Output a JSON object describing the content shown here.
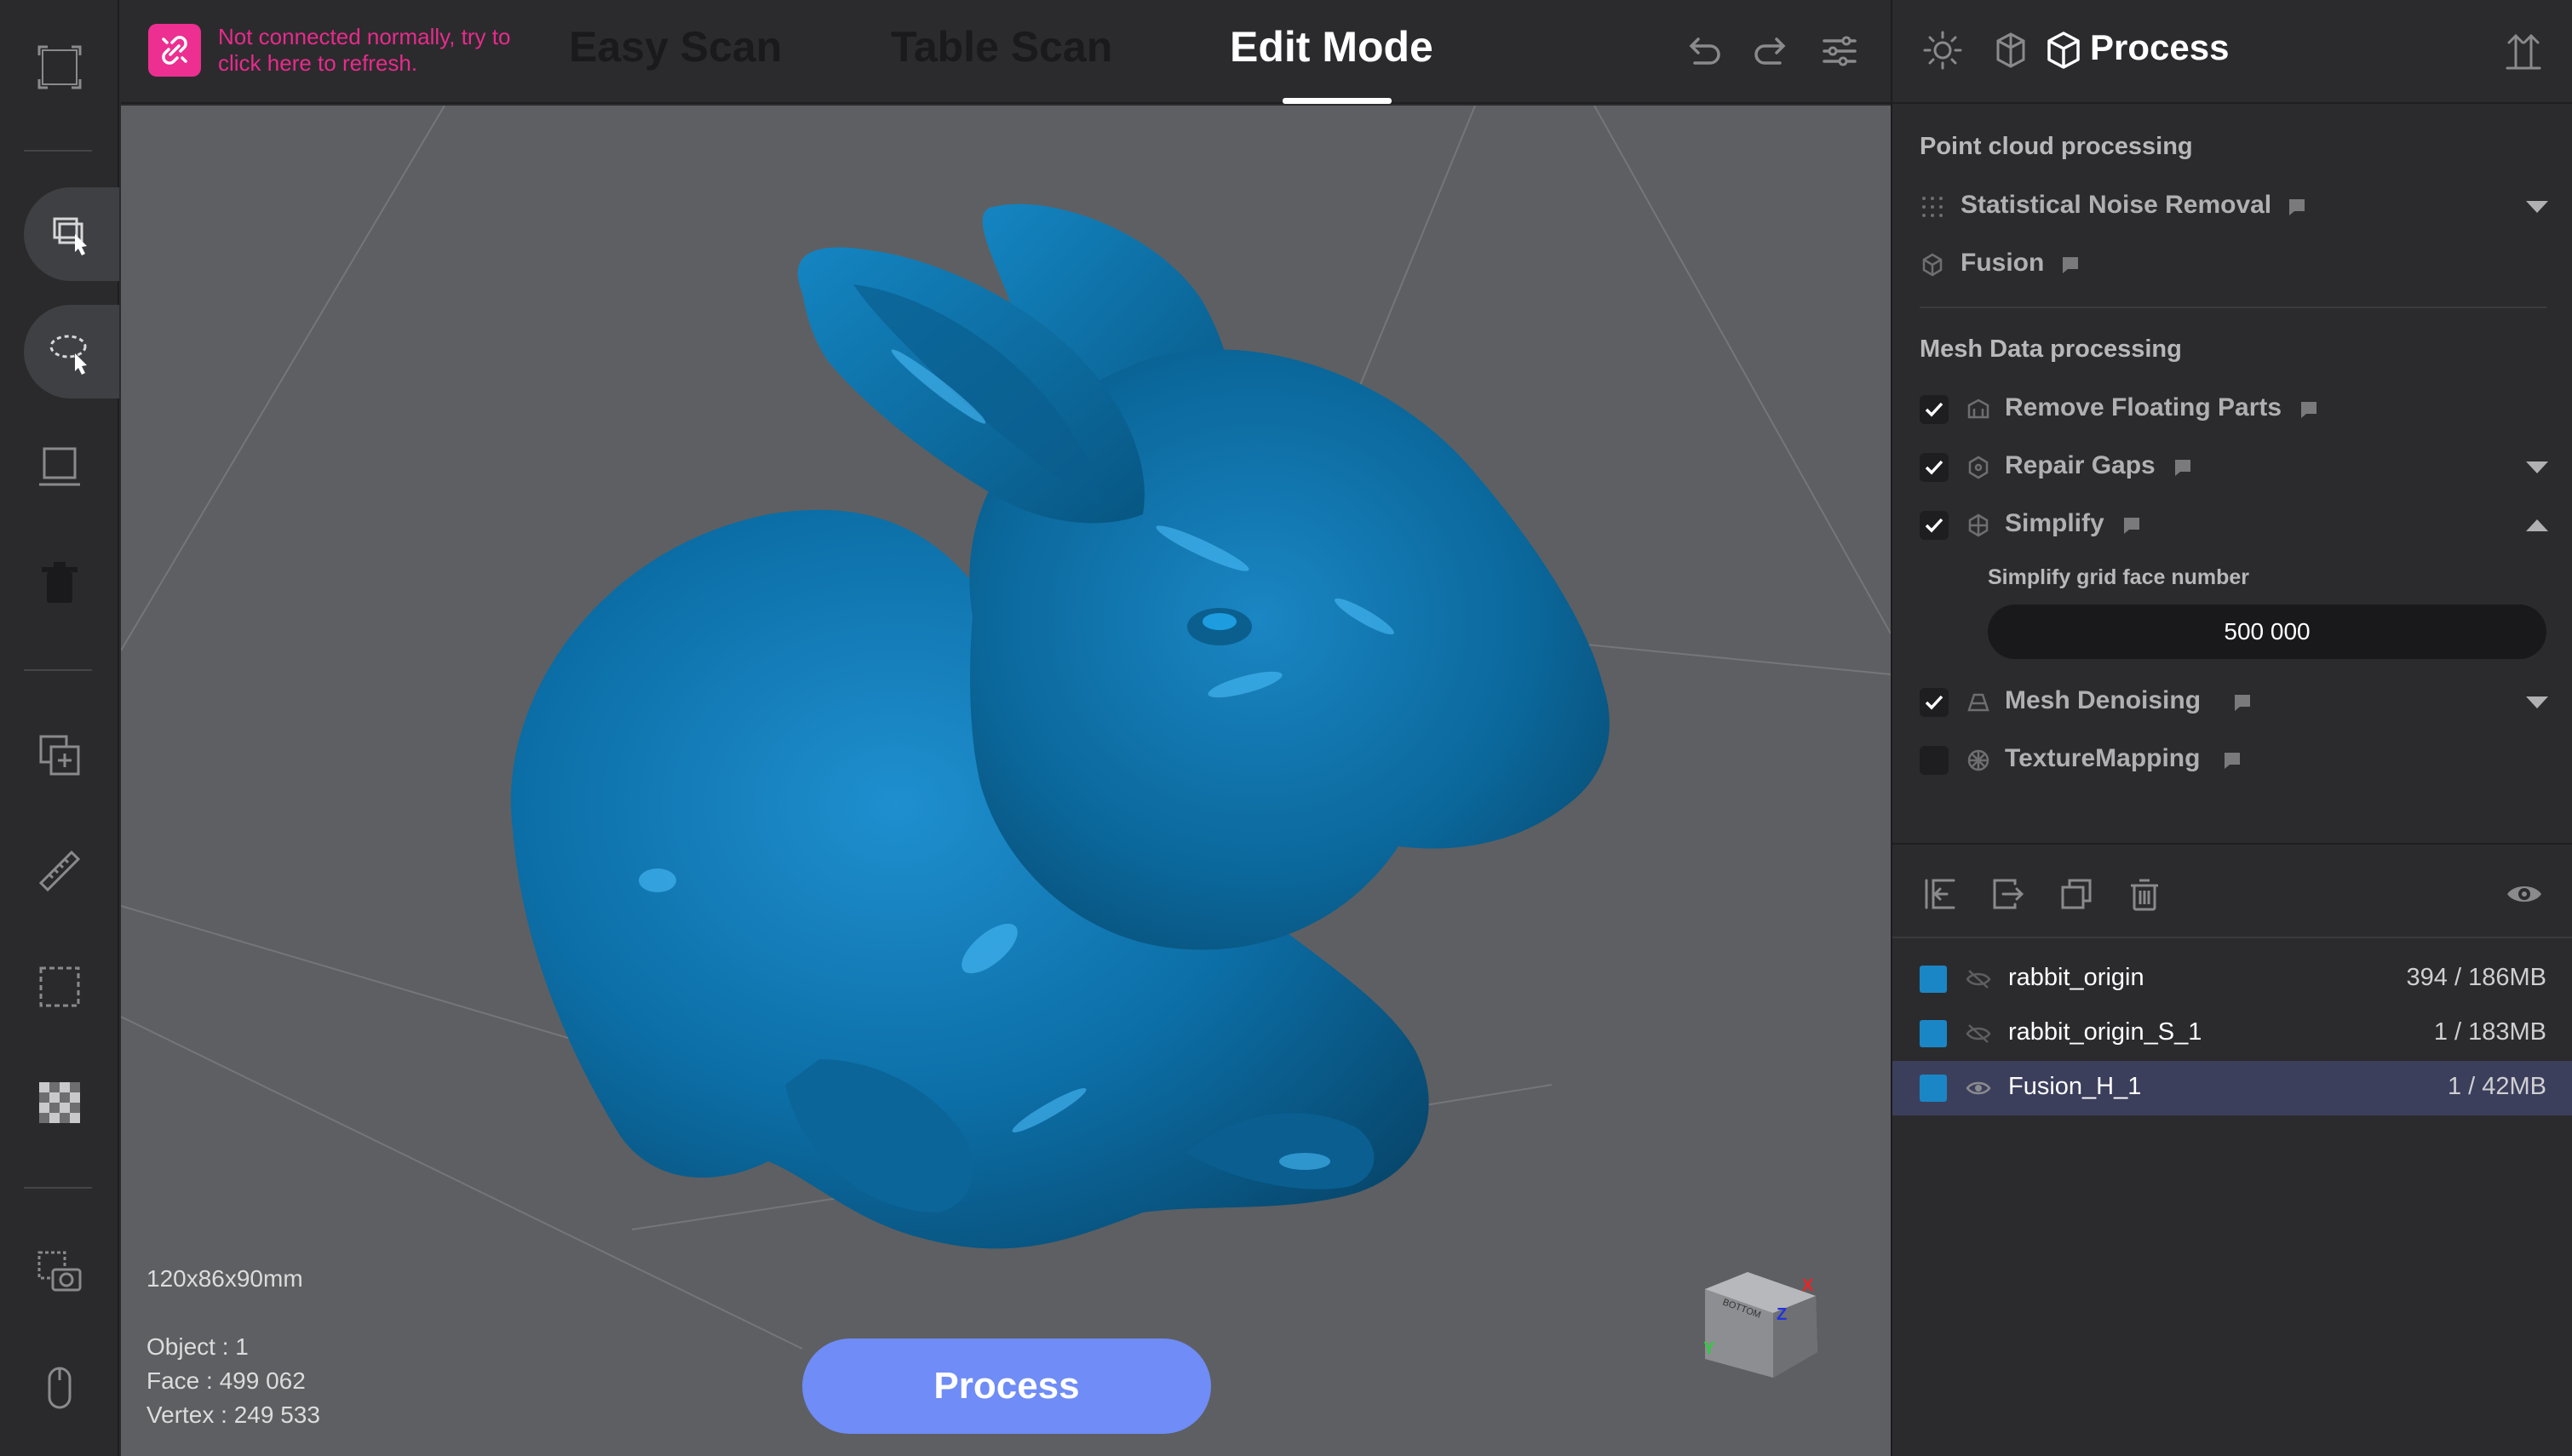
{
  "connection": {
    "message": "Not connected normally, try to click here to refresh."
  },
  "modes": {
    "easy_scan": "Easy Scan",
    "table_scan": "Table Scan",
    "edit_mode": "Edit Mode"
  },
  "viewport": {
    "dimensions": "120x86x90mm",
    "object_count": "Object : 1",
    "face_count": "Face : 499 062",
    "vertex_count": "Vertex : 249 533",
    "process_button": "Process",
    "view_cube": {
      "top_label": "BOTTOM",
      "axis_z": "Z",
      "axis_y": "Y",
      "axis_x": "X"
    },
    "model_color": "#0a6fa6"
  },
  "panel": {
    "title": "Process",
    "point_cloud": {
      "title": "Point cloud processing",
      "items": [
        {
          "label": "Statistical Noise Removal",
          "icon": "dots-grid-icon"
        },
        {
          "label": "Fusion",
          "icon": "fusion-icon"
        }
      ]
    },
    "mesh": {
      "title": "Mesh Data processing",
      "items": [
        {
          "label": "Remove Floating Parts",
          "checked": true
        },
        {
          "label": "Repair Gaps",
          "checked": true
        },
        {
          "label": "Simplify",
          "checked": true
        },
        {
          "label": "Mesh Denoising",
          "checked": true
        },
        {
          "label": "TextureMapping",
          "checked": false
        }
      ],
      "simplify_label": "Simplify grid face number",
      "simplify_value": "500 000"
    },
    "objects": [
      {
        "name": "rabbit_origin",
        "size": "394 / 186MB",
        "color": "#1b86c5",
        "visible": false
      },
      {
        "name": "rabbit_origin_S_1",
        "size": "1 / 183MB",
        "color": "#1b86c5",
        "visible": false
      },
      {
        "name": "Fusion_H_1",
        "size": "1 / 42MB",
        "color": "#1b86c5",
        "visible": true,
        "selected": true
      }
    ]
  },
  "colors": {
    "accent": "#6f8cf7",
    "warning": "#e82b8c",
    "selected_row": "#3b3f5c"
  }
}
